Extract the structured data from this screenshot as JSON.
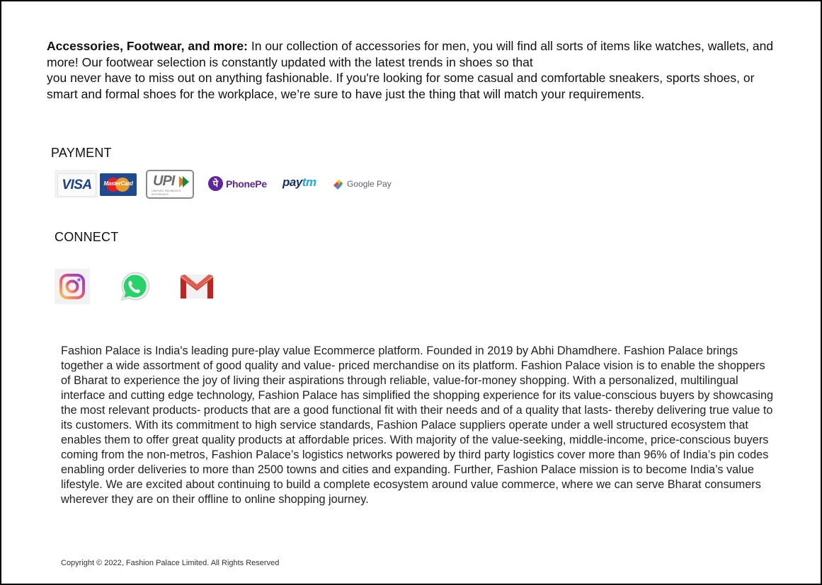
{
  "intro": {
    "lead": "Accessories, Footwear, and more:",
    "text": " In our collection of accessories for men, you will find all sorts of items like watches, wallets, and more! Our footwear selection is constantly updated with the latest trends in shoes so that",
    "text2": "you never have to miss out on anything fashionable. If you're looking for some casual and comfortable sneakers, sports shoes, or smart and formal shoes for the workplace, we’re sure to have just the thing that will match your requirements."
  },
  "payment": {
    "title": "PAYMENT",
    "methods": [
      {
        "name": "VISA",
        "icon": "visa-logo"
      },
      {
        "name": "MasterCard",
        "icon": "mastercard-logo"
      },
      {
        "name": "UPI",
        "sub": "UNIFIED PAYMENTS INTERFACE",
        "icon": "upi-logo"
      },
      {
        "name": "PhonePe",
        "icon": "phonepe-logo"
      },
      {
        "name_pay": "pay",
        "name_tm": "tm",
        "icon": "paytm-logo"
      },
      {
        "name": "Google Pay",
        "icon": "google-pay-logo"
      }
    ]
  },
  "connect": {
    "title": "CONNECT",
    "links": [
      {
        "icon": "instagram-icon"
      },
      {
        "icon": "whatsapp-icon"
      },
      {
        "icon": "gmail-icon"
      }
    ]
  },
  "about": {
    "text": "Fashion Palace is India's leading pure-play value Ecommerce platform. Founded in 2019 by Abhi Dhamdhere. Fashion Palace brings together a wide assortment of good quality and value- priced merchandise on its platform. Fashion Palace vision is to enable the shoppers of Bharat to experience the joy of living their aspirations through reliable, value-for-money shopping. With a personalized, multilingual interface and cutting edge technology, Fashion Palace  has simplified the shopping experience for its value-conscious buyers by showcasing the most relevant products- products that are a good functional fit with their needs and of a quality that lasts- thereby delivering true value to its customers. With its commitment to high service standards, Fashion Palace suppliers operate under a well structured ecosystem that enables them to offer great quality products at affordable prices. With majority of the value-seeking, middle-income, price-conscious buyers coming from the non-metros, Fashion Palace’s logistics networks powered by third party logistics cover more than 96% of India’s pin codes enabling order deliveries to more than 2500 towns and cities and expanding. Further, Fashion Palace mission is to become India’s value lifestyle. We are excited about continuing to build a complete ecosystem around value commerce, where we can serve Bharat consumers wherever they are on their offline to online shopping journey."
  },
  "footer": {
    "copyright": "Copyright © 2022, Fashion Palace Limited. All Rights Reserved"
  },
  "colors": {
    "visa_blue": "#1a3f8f",
    "phonepe_purple": "#5f259f",
    "paytm_navy": "#16306b",
    "paytm_cyan": "#1ba9e1",
    "whatsapp_green": "#25d366",
    "gmail_red": "#d44638"
  }
}
